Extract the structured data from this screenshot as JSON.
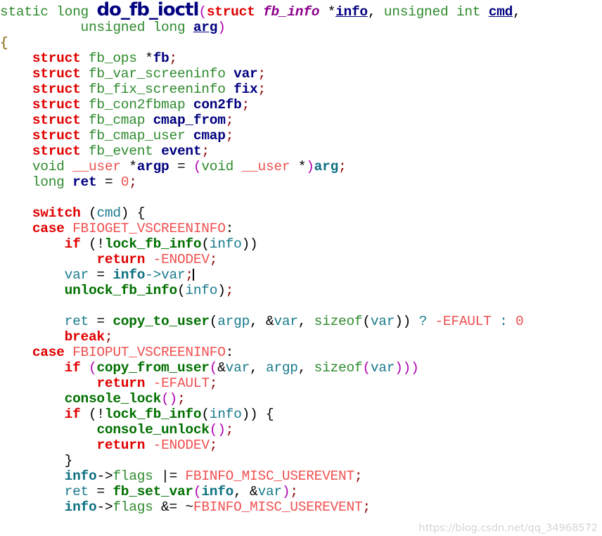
{
  "document": {
    "language": "C",
    "function_name": "do_fb_ioctl",
    "background_color": "#ffffff"
  },
  "palette": {
    "keyword": "#e00000",
    "type": "#2e8b2e",
    "function": "#007000",
    "variable_declared": "#000080",
    "identifier": "#1a7b8c",
    "macro_constant": "#f05050",
    "paren": "#b000b0",
    "plain": "#000000",
    "watermark": "#d4d4d4"
  },
  "watermark": {
    "text": "https://blog.csdn.net/qq_34968572"
  },
  "lines": [
    {
      "n": 1,
      "tokens": [
        {
          "t": "static long ",
          "c": "t-type"
        },
        {
          "t": "do_fb_ioctl",
          "c": "t-title"
        },
        {
          "t": "(",
          "c": "t-paren"
        },
        {
          "t": "struct",
          "c": "t-kw"
        },
        {
          "t": " ",
          "c": "t-plain"
        },
        {
          "t": "fb_info",
          "c": "t-param"
        },
        {
          "t": " *",
          "c": "t-plain"
        },
        {
          "t": "info",
          "c": "t-ulink"
        },
        {
          "t": ", ",
          "c": "t-plain"
        },
        {
          "t": "unsigned int",
          "c": "t-type"
        },
        {
          "t": " ",
          "c": "t-plain"
        },
        {
          "t": "cmd",
          "c": "t-ulink"
        },
        {
          "t": ",",
          "c": "t-plain"
        }
      ]
    },
    {
      "n": 2,
      "tokens": [
        {
          "t": "          ",
          "c": "t-plain"
        },
        {
          "t": "unsigned long",
          "c": "t-type"
        },
        {
          "t": " ",
          "c": "t-plain"
        },
        {
          "t": "arg",
          "c": "t-ulink"
        },
        {
          "t": ")",
          "c": "t-paren"
        }
      ]
    },
    {
      "n": 3,
      "tokens": [
        {
          "t": "{",
          "c": "t-brace"
        }
      ]
    },
    {
      "n": 4,
      "tokens": [
        {
          "t": "    ",
          "c": "t-plain"
        },
        {
          "t": "struct",
          "c": "t-kw"
        },
        {
          "t": " ",
          "c": "t-plain"
        },
        {
          "t": "fb_ops",
          "c": "t-typename"
        },
        {
          "t": " *",
          "c": "t-plain"
        },
        {
          "t": "fb",
          "c": "t-var"
        },
        {
          "t": ";",
          "c": "t-punct"
        }
      ]
    },
    {
      "n": 5,
      "tokens": [
        {
          "t": "    ",
          "c": "t-plain"
        },
        {
          "t": "struct",
          "c": "t-kw"
        },
        {
          "t": " ",
          "c": "t-plain"
        },
        {
          "t": "fb_var_screeninfo",
          "c": "t-typename"
        },
        {
          "t": " ",
          "c": "t-plain"
        },
        {
          "t": "var",
          "c": "t-var"
        },
        {
          "t": ";",
          "c": "t-punct"
        }
      ]
    },
    {
      "n": 6,
      "tokens": [
        {
          "t": "    ",
          "c": "t-plain"
        },
        {
          "t": "struct",
          "c": "t-kw"
        },
        {
          "t": " ",
          "c": "t-plain"
        },
        {
          "t": "fb_fix_screeninfo",
          "c": "t-typename"
        },
        {
          "t": " ",
          "c": "t-plain"
        },
        {
          "t": "fix",
          "c": "t-var"
        },
        {
          "t": ";",
          "c": "t-punct"
        }
      ]
    },
    {
      "n": 7,
      "tokens": [
        {
          "t": "    ",
          "c": "t-plain"
        },
        {
          "t": "struct",
          "c": "t-kw"
        },
        {
          "t": " ",
          "c": "t-plain"
        },
        {
          "t": "fb_con2fbmap",
          "c": "t-typename"
        },
        {
          "t": " ",
          "c": "t-plain"
        },
        {
          "t": "con2fb",
          "c": "t-var"
        },
        {
          "t": ";",
          "c": "t-punct"
        }
      ]
    },
    {
      "n": 8,
      "tokens": [
        {
          "t": "    ",
          "c": "t-plain"
        },
        {
          "t": "struct",
          "c": "t-kw"
        },
        {
          "t": " ",
          "c": "t-plain"
        },
        {
          "t": "fb_cmap",
          "c": "t-typename"
        },
        {
          "t": " ",
          "c": "t-plain"
        },
        {
          "t": "cmap_from",
          "c": "t-var"
        },
        {
          "t": ";",
          "c": "t-punct"
        }
      ]
    },
    {
      "n": 9,
      "tokens": [
        {
          "t": "    ",
          "c": "t-plain"
        },
        {
          "t": "struct",
          "c": "t-kw"
        },
        {
          "t": " ",
          "c": "t-plain"
        },
        {
          "t": "fb_cmap_user",
          "c": "t-typename"
        },
        {
          "t": " ",
          "c": "t-plain"
        },
        {
          "t": "cmap",
          "c": "t-var"
        },
        {
          "t": ";",
          "c": "t-punct"
        }
      ]
    },
    {
      "n": 10,
      "tokens": [
        {
          "t": "    ",
          "c": "t-plain"
        },
        {
          "t": "struct",
          "c": "t-kw"
        },
        {
          "t": " ",
          "c": "t-plain"
        },
        {
          "t": "fb_event",
          "c": "t-typename"
        },
        {
          "t": " ",
          "c": "t-plain"
        },
        {
          "t": "event",
          "c": "t-var"
        },
        {
          "t": ";",
          "c": "t-punct"
        }
      ]
    },
    {
      "n": 11,
      "tokens": [
        {
          "t": "    ",
          "c": "t-plain"
        },
        {
          "t": "void",
          "c": "t-type"
        },
        {
          "t": " ",
          "c": "t-plain"
        },
        {
          "t": "__user",
          "c": "t-const"
        },
        {
          "t": " *",
          "c": "t-plain"
        },
        {
          "t": "argp",
          "c": "t-var"
        },
        {
          "t": " = ",
          "c": "t-plain"
        },
        {
          "t": "(",
          "c": "t-paren"
        },
        {
          "t": "void",
          "c": "t-type"
        },
        {
          "t": " ",
          "c": "t-plain"
        },
        {
          "t": "__user",
          "c": "t-const"
        },
        {
          "t": " *",
          "c": "t-plain"
        },
        {
          "t": ")",
          "c": "t-paren"
        },
        {
          "t": "arg",
          "c": "t-identb"
        },
        {
          "t": ";",
          "c": "t-punct"
        }
      ]
    },
    {
      "n": 12,
      "tokens": [
        {
          "t": "    ",
          "c": "t-plain"
        },
        {
          "t": "long",
          "c": "t-type"
        },
        {
          "t": " ",
          "c": "t-plain"
        },
        {
          "t": "ret",
          "c": "t-var"
        },
        {
          "t": " = ",
          "c": "t-plain"
        },
        {
          "t": "0",
          "c": "t-const"
        },
        {
          "t": ";",
          "c": "t-punct"
        }
      ]
    },
    {
      "n": 13,
      "tokens": [
        {
          "t": "",
          "c": "t-plain"
        }
      ]
    },
    {
      "n": 14,
      "tokens": [
        {
          "t": "    ",
          "c": "t-plain"
        },
        {
          "t": "switch",
          "c": "t-kw"
        },
        {
          "t": " (",
          "c": "t-plain"
        },
        {
          "t": "cmd",
          "c": "t-ident"
        },
        {
          "t": ") {",
          "c": "t-plain"
        }
      ]
    },
    {
      "n": 15,
      "tokens": [
        {
          "t": "    ",
          "c": "t-plain"
        },
        {
          "t": "case",
          "c": "t-kw"
        },
        {
          "t": " ",
          "c": "t-plain"
        },
        {
          "t": "FBIOGET_VSCREENINFO",
          "c": "t-const"
        },
        {
          "t": ":",
          "c": "t-plain"
        }
      ]
    },
    {
      "n": 16,
      "tokens": [
        {
          "t": "        ",
          "c": "t-plain"
        },
        {
          "t": "if",
          "c": "t-kw"
        },
        {
          "t": " (!",
          "c": "t-plain"
        },
        {
          "t": "lock_fb_info",
          "c": "t-fn"
        },
        {
          "t": "(",
          "c": "t-plain"
        },
        {
          "t": "info",
          "c": "t-ident"
        },
        {
          "t": "))",
          "c": "t-plain"
        }
      ]
    },
    {
      "n": 17,
      "tokens": [
        {
          "t": "            ",
          "c": "t-plain"
        },
        {
          "t": "return",
          "c": "t-kw"
        },
        {
          "t": " -",
          "c": "t-const"
        },
        {
          "t": "ENODEV",
          "c": "t-const"
        },
        {
          "t": ";",
          "c": "t-punct"
        }
      ]
    },
    {
      "n": 18,
      "tokens": [
        {
          "t": "        ",
          "c": "t-plain"
        },
        {
          "t": "var",
          "c": "t-ident"
        },
        {
          "t": " = ",
          "c": "t-plain"
        },
        {
          "t": "info",
          "c": "t-identb"
        },
        {
          "t": "->",
          "c": "t-ident"
        },
        {
          "t": "var",
          "c": "t-ident"
        },
        {
          "t": ";",
          "c": "t-punct"
        },
        {
          "t": "|CARET|",
          "c": "caret"
        }
      ]
    },
    {
      "n": 19,
      "tokens": [
        {
          "t": "        ",
          "c": "t-plain"
        },
        {
          "t": "unlock_fb_info",
          "c": "t-fn"
        },
        {
          "t": "(",
          "c": "t-plain"
        },
        {
          "t": "info",
          "c": "t-ident"
        },
        {
          "t": ")",
          "c": "t-plain"
        },
        {
          "t": ";",
          "c": "t-punct"
        }
      ]
    },
    {
      "n": 20,
      "tokens": [
        {
          "t": "",
          "c": "t-plain"
        }
      ]
    },
    {
      "n": 21,
      "tokens": [
        {
          "t": "        ",
          "c": "t-plain"
        },
        {
          "t": "ret",
          "c": "t-ident"
        },
        {
          "t": " = ",
          "c": "t-plain"
        },
        {
          "t": "copy_to_user",
          "c": "t-fn"
        },
        {
          "t": "(",
          "c": "t-plain"
        },
        {
          "t": "argp",
          "c": "t-ident"
        },
        {
          "t": ", &",
          "c": "t-plain"
        },
        {
          "t": "var",
          "c": "t-ident"
        },
        {
          "t": ", ",
          "c": "t-plain"
        },
        {
          "t": "sizeof",
          "c": "t-type"
        },
        {
          "t": "(",
          "c": "t-plain"
        },
        {
          "t": "var",
          "c": "t-ident"
        },
        {
          "t": ")) ",
          "c": "t-plain"
        },
        {
          "t": "?",
          "c": "t-ident"
        },
        {
          "t": " -",
          "c": "t-const"
        },
        {
          "t": "EFAULT",
          "c": "t-const"
        },
        {
          "t": " ",
          "c": "t-plain"
        },
        {
          "t": ":",
          "c": "t-ident"
        },
        {
          "t": " ",
          "c": "t-plain"
        },
        {
          "t": "0",
          "c": "t-const"
        }
      ]
    },
    {
      "n": 22,
      "tokens": [
        {
          "t": "        ",
          "c": "t-plain"
        },
        {
          "t": "break",
          "c": "t-kw"
        },
        {
          "t": ";",
          "c": "t-punct"
        }
      ]
    },
    {
      "n": 23,
      "tokens": [
        {
          "t": "    ",
          "c": "t-plain"
        },
        {
          "t": "case",
          "c": "t-kw"
        },
        {
          "t": " ",
          "c": "t-plain"
        },
        {
          "t": "FBIOPUT_VSCREENINFO",
          "c": "t-const"
        },
        {
          "t": ":",
          "c": "t-plain"
        }
      ]
    },
    {
      "n": 24,
      "tokens": [
        {
          "t": "        ",
          "c": "t-plain"
        },
        {
          "t": "if",
          "c": "t-kw"
        },
        {
          "t": " ",
          "c": "t-plain"
        },
        {
          "t": "(",
          "c": "t-paren"
        },
        {
          "t": "copy_from_user",
          "c": "t-fn"
        },
        {
          "t": "(",
          "c": "t-paren"
        },
        {
          "t": "&",
          "c": "t-plain"
        },
        {
          "t": "var",
          "c": "t-ident"
        },
        {
          "t": ", ",
          "c": "t-plain"
        },
        {
          "t": "argp",
          "c": "t-ident"
        },
        {
          "t": ", ",
          "c": "t-plain"
        },
        {
          "t": "sizeof",
          "c": "t-type"
        },
        {
          "t": "(",
          "c": "t-paren"
        },
        {
          "t": "var",
          "c": "t-ident"
        },
        {
          "t": ")))",
          "c": "t-paren"
        }
      ]
    },
    {
      "n": 25,
      "tokens": [
        {
          "t": "            ",
          "c": "t-plain"
        },
        {
          "t": "return",
          "c": "t-kw"
        },
        {
          "t": " -",
          "c": "t-const"
        },
        {
          "t": "EFAULT",
          "c": "t-const"
        },
        {
          "t": ";",
          "c": "t-punct"
        }
      ]
    },
    {
      "n": 26,
      "tokens": [
        {
          "t": "        ",
          "c": "t-plain"
        },
        {
          "t": "console_lock",
          "c": "t-fn"
        },
        {
          "t": "()",
          "c": "t-paren"
        },
        {
          "t": ";",
          "c": "t-punct"
        }
      ]
    },
    {
      "n": 27,
      "tokens": [
        {
          "t": "        ",
          "c": "t-plain"
        },
        {
          "t": "if",
          "c": "t-kw"
        },
        {
          "t": " (!",
          "c": "t-plain"
        },
        {
          "t": "lock_fb_info",
          "c": "t-fn"
        },
        {
          "t": "(",
          "c": "t-plain"
        },
        {
          "t": "info",
          "c": "t-ident"
        },
        {
          "t": ")) {",
          "c": "t-plain"
        }
      ]
    },
    {
      "n": 28,
      "tokens": [
        {
          "t": "            ",
          "c": "t-plain"
        },
        {
          "t": "console_unlock",
          "c": "t-fn"
        },
        {
          "t": "()",
          "c": "t-paren"
        },
        {
          "t": ";",
          "c": "t-punct"
        }
      ]
    },
    {
      "n": 29,
      "tokens": [
        {
          "t": "            ",
          "c": "t-plain"
        },
        {
          "t": "return",
          "c": "t-kw"
        },
        {
          "t": " -",
          "c": "t-const"
        },
        {
          "t": "ENODEV",
          "c": "t-const"
        },
        {
          "t": ";",
          "c": "t-punct"
        }
      ]
    },
    {
      "n": 30,
      "tokens": [
        {
          "t": "        }",
          "c": "t-plain"
        }
      ]
    },
    {
      "n": 31,
      "tokens": [
        {
          "t": "        ",
          "c": "t-plain"
        },
        {
          "t": "info",
          "c": "t-identb"
        },
        {
          "t": "->",
          "c": "t-plain"
        },
        {
          "t": "flags",
          "c": "t-typename"
        },
        {
          "t": " |= ",
          "c": "t-plain"
        },
        {
          "t": "FBINFO_MISC_USEREVENT",
          "c": "t-const"
        },
        {
          "t": ";",
          "c": "t-punct"
        }
      ]
    },
    {
      "n": 32,
      "tokens": [
        {
          "t": "        ",
          "c": "t-plain"
        },
        {
          "t": "ret",
          "c": "t-ident"
        },
        {
          "t": " = ",
          "c": "t-plain"
        },
        {
          "t": "fb_set_var",
          "c": "t-fn"
        },
        {
          "t": "(",
          "c": "t-paren"
        },
        {
          "t": "info",
          "c": "t-identb"
        },
        {
          "t": ", &",
          "c": "t-plain"
        },
        {
          "t": "var",
          "c": "t-ident"
        },
        {
          "t": ")",
          "c": "t-paren"
        },
        {
          "t": ";",
          "c": "t-punct"
        }
      ]
    },
    {
      "n": 33,
      "tokens": [
        {
          "t": "        ",
          "c": "t-plain"
        },
        {
          "t": "info",
          "c": "t-identb"
        },
        {
          "t": "->",
          "c": "t-plain"
        },
        {
          "t": "flags",
          "c": "t-typename"
        },
        {
          "t": " &= ~",
          "c": "t-plain"
        },
        {
          "t": "FBINFO_MISC_USEREVENT",
          "c": "t-const"
        },
        {
          "t": ";",
          "c": "t-punct"
        }
      ]
    }
  ]
}
